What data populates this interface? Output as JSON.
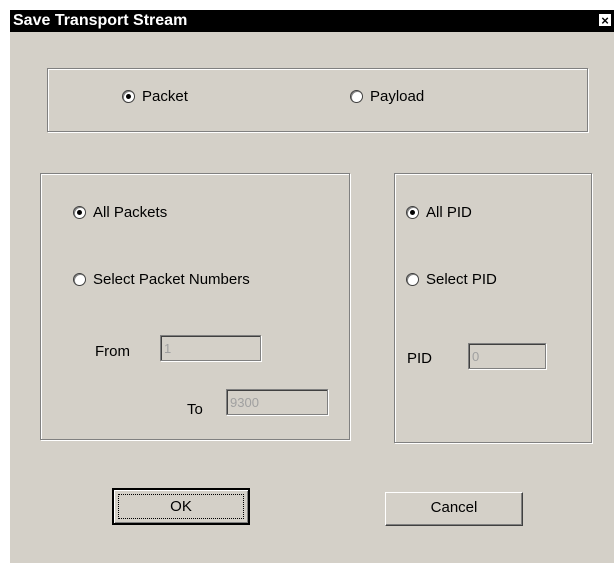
{
  "window": {
    "title": "Save Transport Stream",
    "close_glyph": "×"
  },
  "mode": {
    "packet_label": "Packet",
    "payload_label": "Payload",
    "selected": "Packet"
  },
  "packets": {
    "all_label": "All Packets",
    "select_label": "Select Packet Numbers",
    "selected": "All Packets",
    "from_label": "From",
    "from_value": "1",
    "to_label": "To",
    "to_value": "9300"
  },
  "pid": {
    "all_label": "All PID",
    "select_label": "Select PID",
    "selected": "All PID",
    "pid_label": "PID",
    "pid_value": "0"
  },
  "buttons": {
    "ok_label": "OK",
    "cancel_label": "Cancel"
  },
  "colors": {
    "dialog_bg": "#d4d0c8",
    "titlebar_bg": "#000000",
    "title_text": "#ffffff",
    "disabled_text": "#a0a0a0"
  },
  "icons": {
    "close": "close-icon",
    "radio_checked": "radio-checked-icon",
    "radio_unchecked": "radio-unchecked-icon"
  }
}
